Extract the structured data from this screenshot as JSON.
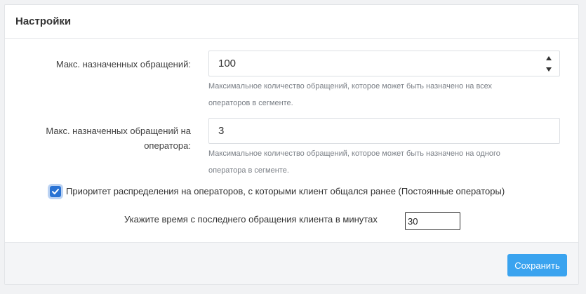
{
  "panel": {
    "title": "Настройки"
  },
  "fields": {
    "max_assigned": {
      "label": "Макс. назначенных обращений:",
      "value": "100",
      "help_line1": "Максимальное количество обращений, которое может быть назначено на всех",
      "help_line2": "операторов в сегменте."
    },
    "max_per_operator": {
      "label_line1": "Макс. назначенных обращений на",
      "label_line2": "оператора:",
      "value": "3",
      "help_line1": "Максимальное количество обращений, которое может быть назначено на одного",
      "help_line2": "оператора в сегменте."
    }
  },
  "priority": {
    "checked": true,
    "label": "Приоритет распределения на операторов, с которыми клиент общался ранее (Постоянные операторы)",
    "minutes_label": "Укажите время с последнего обращения клиента в минутах",
    "minutes_value": "30"
  },
  "footer": {
    "save_label": "Сохранить"
  },
  "colors": {
    "accent": "#3aa3ef",
    "checkbox": "#2a73d4"
  }
}
